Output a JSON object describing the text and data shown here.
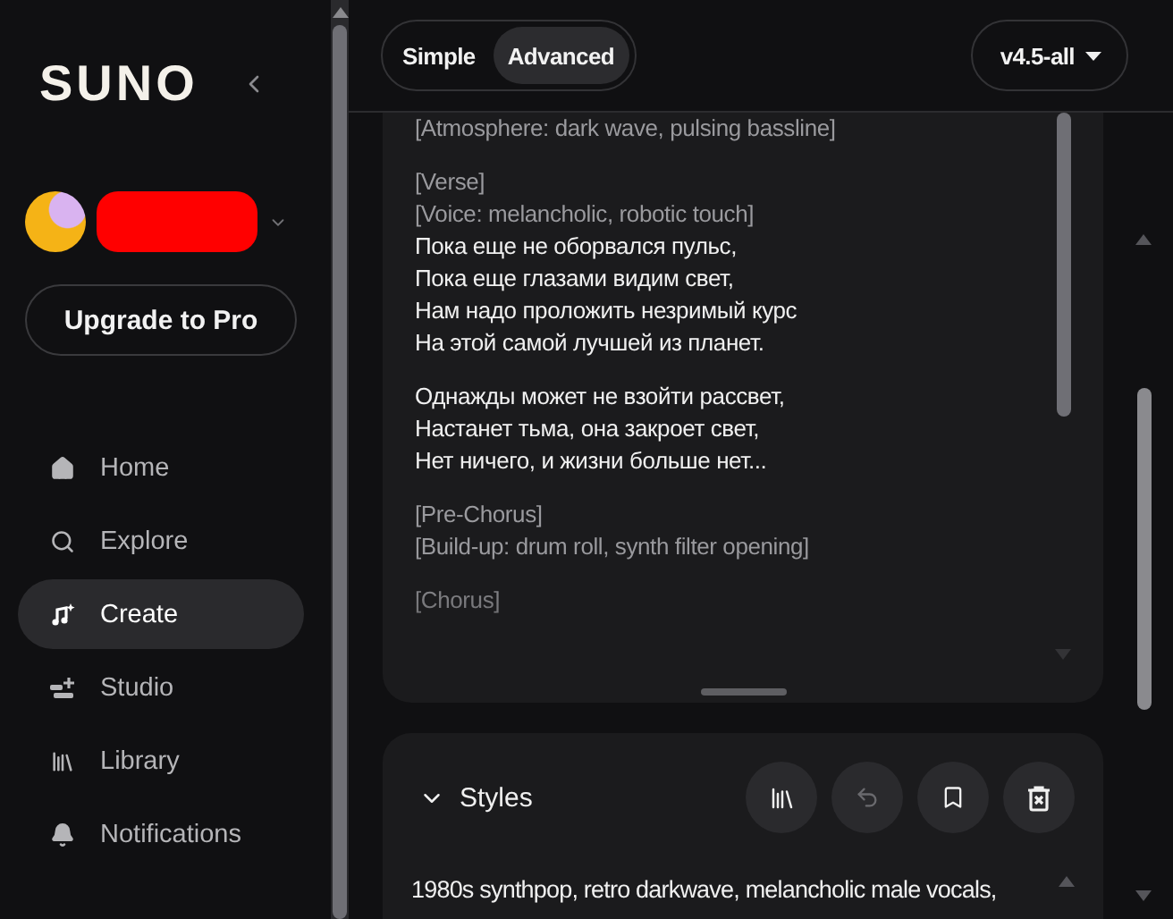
{
  "sidebar": {
    "logo": "SUNO",
    "account": {
      "redacted": true
    },
    "upgrade_button": "Upgrade to Pro",
    "items": [
      {
        "label": "Home",
        "selected": false
      },
      {
        "label": "Explore",
        "selected": false
      },
      {
        "label": "Create",
        "selected": true
      },
      {
        "label": "Studio",
        "selected": false
      },
      {
        "label": "Library",
        "selected": false
      },
      {
        "label": "Notifications",
        "selected": false
      }
    ]
  },
  "mode_tabs": [
    {
      "label": "Simple",
      "selected": false
    },
    {
      "label": "Advanced",
      "selected": true
    }
  ],
  "model_select": {
    "value": "v4.5-all"
  },
  "lyrics": {
    "stanzas": [
      {
        "lines": [
          {
            "kind": "tag",
            "text": "[Atmosphere: dark wave, pulsing bassline]"
          }
        ]
      },
      {
        "lines": [
          {
            "kind": "tag",
            "text": "[Verse]"
          },
          {
            "kind": "tag",
            "text": "[Voice: melancholic, robotic touch]"
          },
          {
            "kind": "lyric",
            "text": "Пока еще не оборвался пульс,"
          },
          {
            "kind": "lyric",
            "text": "Пока еще глазами видим свет,"
          },
          {
            "kind": "lyric",
            "text": "Нам надо проложить незримый курс"
          },
          {
            "kind": "lyric",
            "text": "На этой самой лучшей из планет."
          }
        ]
      },
      {
        "lines": [
          {
            "kind": "lyric",
            "text": "Однажды может не взойти рассвет,"
          },
          {
            "kind": "lyric",
            "text": "Настанет тьма, она закроет свет,"
          },
          {
            "kind": "lyric",
            "text": "Нет ничего, и жизни больше нет..."
          }
        ]
      },
      {
        "lines": [
          {
            "kind": "tag",
            "text": "[Pre-Chorus]"
          },
          {
            "kind": "tag",
            "text": "[Build-up: drum roll, synth filter opening]"
          }
        ]
      },
      {
        "lines": [
          {
            "kind": "tag",
            "text": "[Chorus]"
          }
        ]
      }
    ]
  },
  "styles": {
    "title": "Styles",
    "expanded": true,
    "actions": [
      {
        "disabled": false
      },
      {
        "disabled": true
      },
      {
        "disabled": false
      },
      {
        "disabled": false
      }
    ],
    "text": "1980s synthpop, retro darkwave, melancholic male vocals,"
  }
}
